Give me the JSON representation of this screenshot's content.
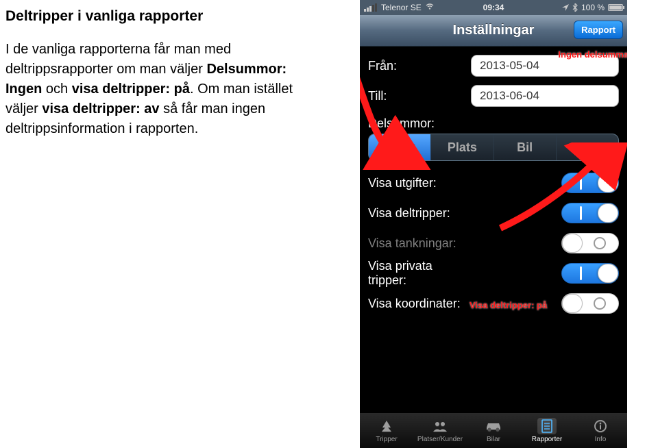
{
  "doc": {
    "title": "Deltripper i vanliga rapporter",
    "p1a": "I de vanliga rapporterna får man med deltrippsrapporter om man väljer ",
    "p1b": "Delsummor: Ingen",
    "p1c": " och ",
    "p1d": "visa deltripper: på",
    "p1e": ". Om man istället väljer ",
    "p1f": "visa deltripper: av",
    "p1g": "  så får man ingen deltrippsinformation i rapporten."
  },
  "status": {
    "carrier": "Telenor SE",
    "time": "09:34",
    "battery": "100 %"
  },
  "nav": {
    "title": "Inställningar",
    "rapport": "Rapport"
  },
  "fields": {
    "from_label": "Från:",
    "from_value": "2013-05-04",
    "to_label": "Till:",
    "to_value": "2013-06-04",
    "delsummor_label": "Delsummor:"
  },
  "seg": {
    "ingen": "Ingen",
    "plats": "Plats",
    "bil": "Bil",
    "skv": "SKV"
  },
  "toggles": {
    "utgifter": "Visa utgifter:",
    "deltripper": "Visa deltripper:",
    "tankningar": "Visa tankningar:",
    "privata": "Visa privata tripper:",
    "koordinater": "Visa koordinater:"
  },
  "tabs": {
    "tripper": "Tripper",
    "platser": "Platser/Kunder",
    "bilar": "Bilar",
    "rapporter": "Rapporter",
    "info": "Info"
  },
  "annots": {
    "a1": "Ingen delsumma",
    "a2": "Visa deltripper: på"
  }
}
